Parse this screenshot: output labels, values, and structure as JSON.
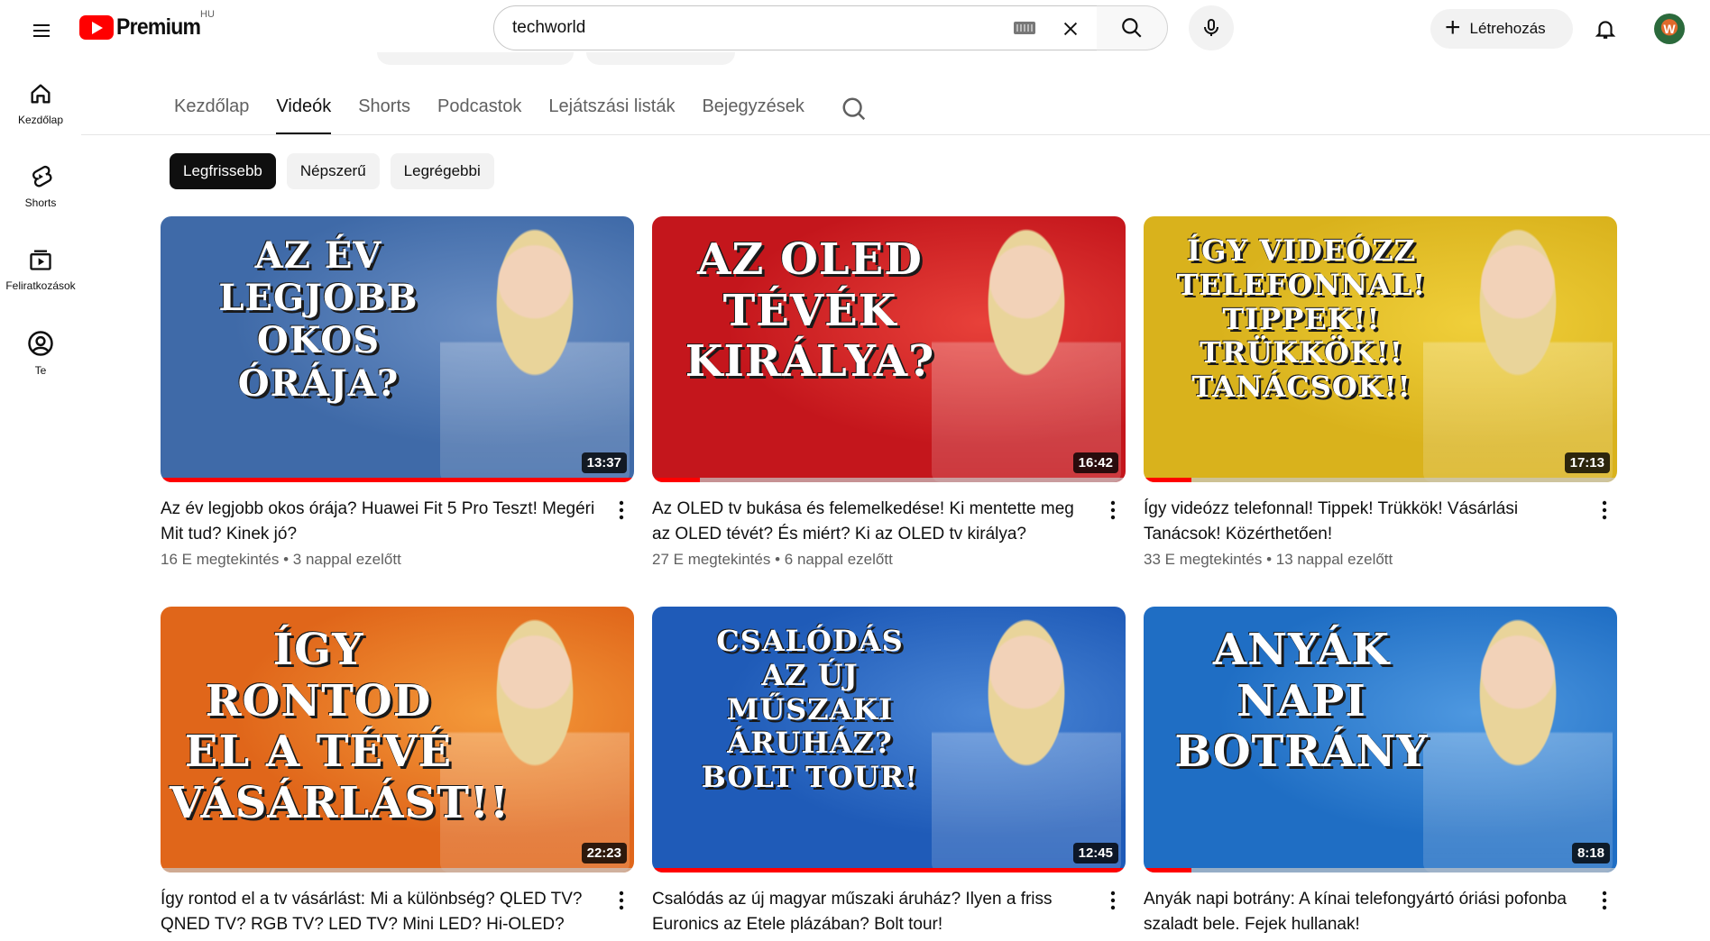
{
  "header": {
    "brand": "Premium",
    "region": "HU",
    "search_query": "techworld",
    "create_label": "Létrehozás",
    "avatar_initial": "W"
  },
  "sidebar": {
    "items": [
      {
        "label": "Kezdőlap",
        "icon": "home-icon"
      },
      {
        "label": "Shorts",
        "icon": "shorts-icon"
      },
      {
        "label": "Feliratkozások",
        "icon": "subscriptions-icon"
      },
      {
        "label": "Te",
        "icon": "you-icon"
      }
    ]
  },
  "tabs": {
    "items": [
      "Kezdőlap",
      "Videók",
      "Shorts",
      "Podcastok",
      "Lejátszási listák",
      "Bejegyzések"
    ],
    "active": "Videók"
  },
  "chips": {
    "items": [
      "Legfrissebb",
      "Népszerű",
      "Legrégebbi"
    ],
    "active": "Legfrissebb"
  },
  "videos": [
    {
      "title": "Az év legjobb okos órája? Huawei Fit 5 Pro Teszt! Megéri Mit tud? Kinek jó?",
      "views": "16 E megtekintés",
      "age": "3 nappal ezelőtt",
      "duration": "13:37",
      "thumb_text": "AZ ÉV\nLEGJOBB\nOKOS\nÓRÁJA?",
      "watched": 1.0,
      "colors": {
        "bg": "#3f6aa8",
        "accent": "#6b8fc4"
      }
    },
    {
      "title": "Az OLED tv bukása és felemelkedése! Ki mentette meg az OLED tévét? És miért? Ki az OLED tv királya?",
      "views": "27 E megtekintés",
      "age": "6 nappal ezelőtt",
      "duration": "16:42",
      "thumb_text": "AZ OLED\nTÉVÉK\nKIRÁLYA?",
      "watched": 0.1,
      "colors": {
        "bg": "#c4161c",
        "accent": "#e8413a"
      }
    },
    {
      "title": "Így videózz telefonnal! Tippek! Trükkök! Vásárlási Tanácsok! Közérthetően!",
      "views": "33 E megtekintés",
      "age": "13 nappal ezelőtt",
      "duration": "17:13",
      "thumb_text": "ÍGY VIDEÓZZ\nTELEFONNAL!\nTIPPEK!!\nTRÜKKÖK!!\nTANÁCSOK!!",
      "watched": 0.1,
      "colors": {
        "bg": "#d9b21c",
        "accent": "#f0cf3a"
      }
    },
    {
      "title": "Így rontod el a tv vásárlást: Mi a különbség?  QLED TV? QNED TV? RGB TV? LED TV? Mini LED? Hi-OLED?",
      "views": "",
      "age": "",
      "duration": "22:23",
      "thumb_text": "ÍGY RONTOD\nEL A TÉVÉ\nVÁSÁRLÁST!!",
      "watched": 0,
      "colors": {
        "bg": "#e0661a",
        "accent": "#f49a3a"
      }
    },
    {
      "title": "Csalódás az új magyar műszaki áruház? Ilyen a friss Euronics az Etele plázában? Bolt tour!",
      "views": "",
      "age": "",
      "duration": "12:45",
      "thumb_text": "CSALÓDÁS\nAZ ÚJ\nMŰSZAKI\nÁRUHÁZ?\nBOLT TOUR!",
      "watched": 1.0,
      "colors": {
        "bg": "#1f5bb8",
        "accent": "#4a86d6"
      }
    },
    {
      "title": "Anyák napi botrány: A kínai telefongyártó óriási pofonba szaladt bele. Fejek hullanak!",
      "views": "",
      "age": "",
      "duration": "8:18",
      "thumb_text": "ANYÁK\nNAPI\nBOTRÁNY",
      "watched": 0.1,
      "colors": {
        "bg": "#1f6ec4",
        "accent": "#4e98e0"
      }
    }
  ]
}
